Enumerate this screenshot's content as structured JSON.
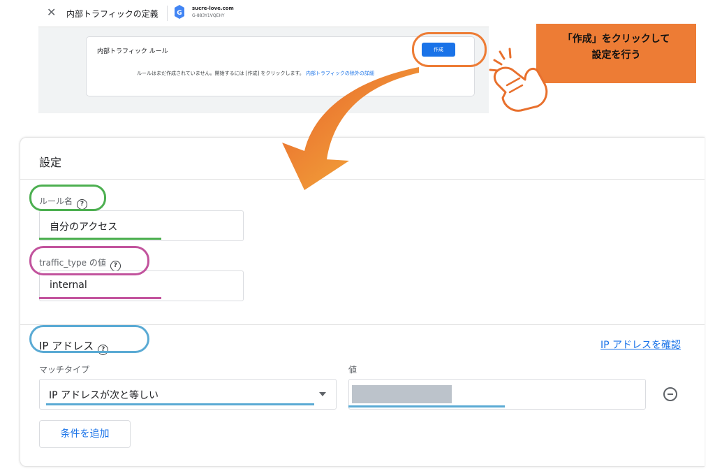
{
  "top_screenshot": {
    "close_glyph": "✕",
    "title": "内部トラフィックの定義",
    "site_name": "sucre-love.com",
    "site_id": "G-883Y1VQEHY",
    "rules_card_title": "内部トラフィック ルール",
    "create_button": "作成",
    "empty_message": "ルールはまだ作成されていません。開始するには [作成] をクリックします。",
    "empty_link": "内部トラフィックの除外の詳細"
  },
  "callout": {
    "text": "「作成」をクリックして\n設定を行う",
    "color": "#ed7c35"
  },
  "settings": {
    "title": "設定",
    "rule_name_label": "ルール名",
    "rule_name_value": "自分のアクセス",
    "traffic_type_label": "traffic_type の値",
    "traffic_type_value": "internal",
    "ip_section_title": "IP アドレス",
    "ip_check_link": "IP アドレスを確認",
    "match_type_label": "マッチタイプ",
    "match_type_value": "IP アドレスが次と等しい",
    "value_label": "値",
    "add_condition_button": "条件を追加",
    "help_glyph": "?"
  },
  "colors": {
    "accent_blue": "#1a73e8",
    "highlight_orange": "#ed7c35",
    "highlight_green": "#4caf50",
    "highlight_magenta": "#c2539d",
    "highlight_blue": "#5aaad4"
  },
  "icons": [
    "close-icon",
    "tag-manager-icon",
    "help-icon",
    "dropdown-arrow-icon",
    "remove-circle-icon",
    "pointing-hand-icon",
    "curved-arrow-icon"
  ]
}
